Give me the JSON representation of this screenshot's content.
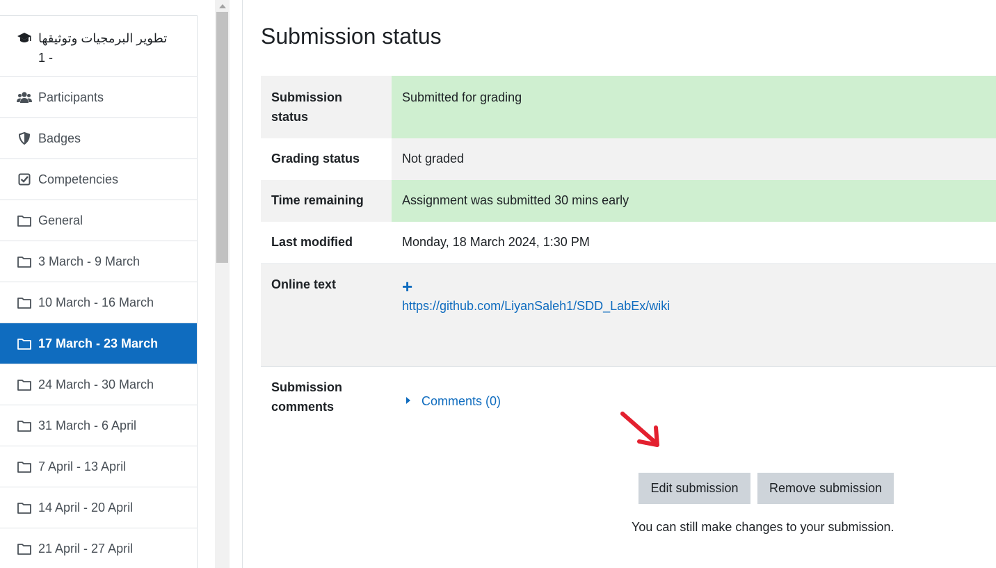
{
  "sidebar": {
    "course": {
      "title_rtl": "تطوير البرمجيات وتوثيقها",
      "title_suffix": "1 -"
    },
    "items": [
      {
        "label": "Participants",
        "icon": "users-icon"
      },
      {
        "label": "Badges",
        "icon": "shield-icon"
      },
      {
        "label": "Competencies",
        "icon": "checkbox-icon"
      },
      {
        "label": "General",
        "icon": "folder-icon"
      },
      {
        "label": "3 March - 9 March",
        "icon": "folder-icon"
      },
      {
        "label": "10 March - 16 March",
        "icon": "folder-icon"
      },
      {
        "label": "17 March - 23 March",
        "icon": "folder-icon",
        "active": true
      },
      {
        "label": "24 March - 30 March",
        "icon": "folder-icon"
      },
      {
        "label": "31 March - 6 April",
        "icon": "folder-icon"
      },
      {
        "label": "7 April - 13 April",
        "icon": "folder-icon"
      },
      {
        "label": "14 April - 20 April",
        "icon": "folder-icon"
      },
      {
        "label": "21 April - 27 April",
        "icon": "folder-icon"
      }
    ]
  },
  "main": {
    "title": "Submission status",
    "rows": {
      "submission_status": {
        "label": "Submission status",
        "value": "Submitted for grading"
      },
      "grading_status": {
        "label": "Grading status",
        "value": "Not graded"
      },
      "time_remaining": {
        "label": "Time remaining",
        "value": "Assignment was submitted 30 mins early"
      },
      "last_modified": {
        "label": "Last modified",
        "value": "Monday, 18 March 2024, 1:30 PM"
      },
      "online_text": {
        "label": "Online text",
        "expand": "+",
        "link": "https://github.com/LiyanSaleh1/SDD_LabEx/wiki"
      },
      "comments": {
        "label": "Submission comments",
        "link": "Comments (0)"
      }
    },
    "buttons": {
      "edit": "Edit submission",
      "remove": "Remove submission"
    },
    "hint": "You can still make changes to your submission."
  },
  "colors": {
    "accent": "#0f6cbf",
    "success_bg": "#cfefd0",
    "annotation": "#e3202f"
  }
}
